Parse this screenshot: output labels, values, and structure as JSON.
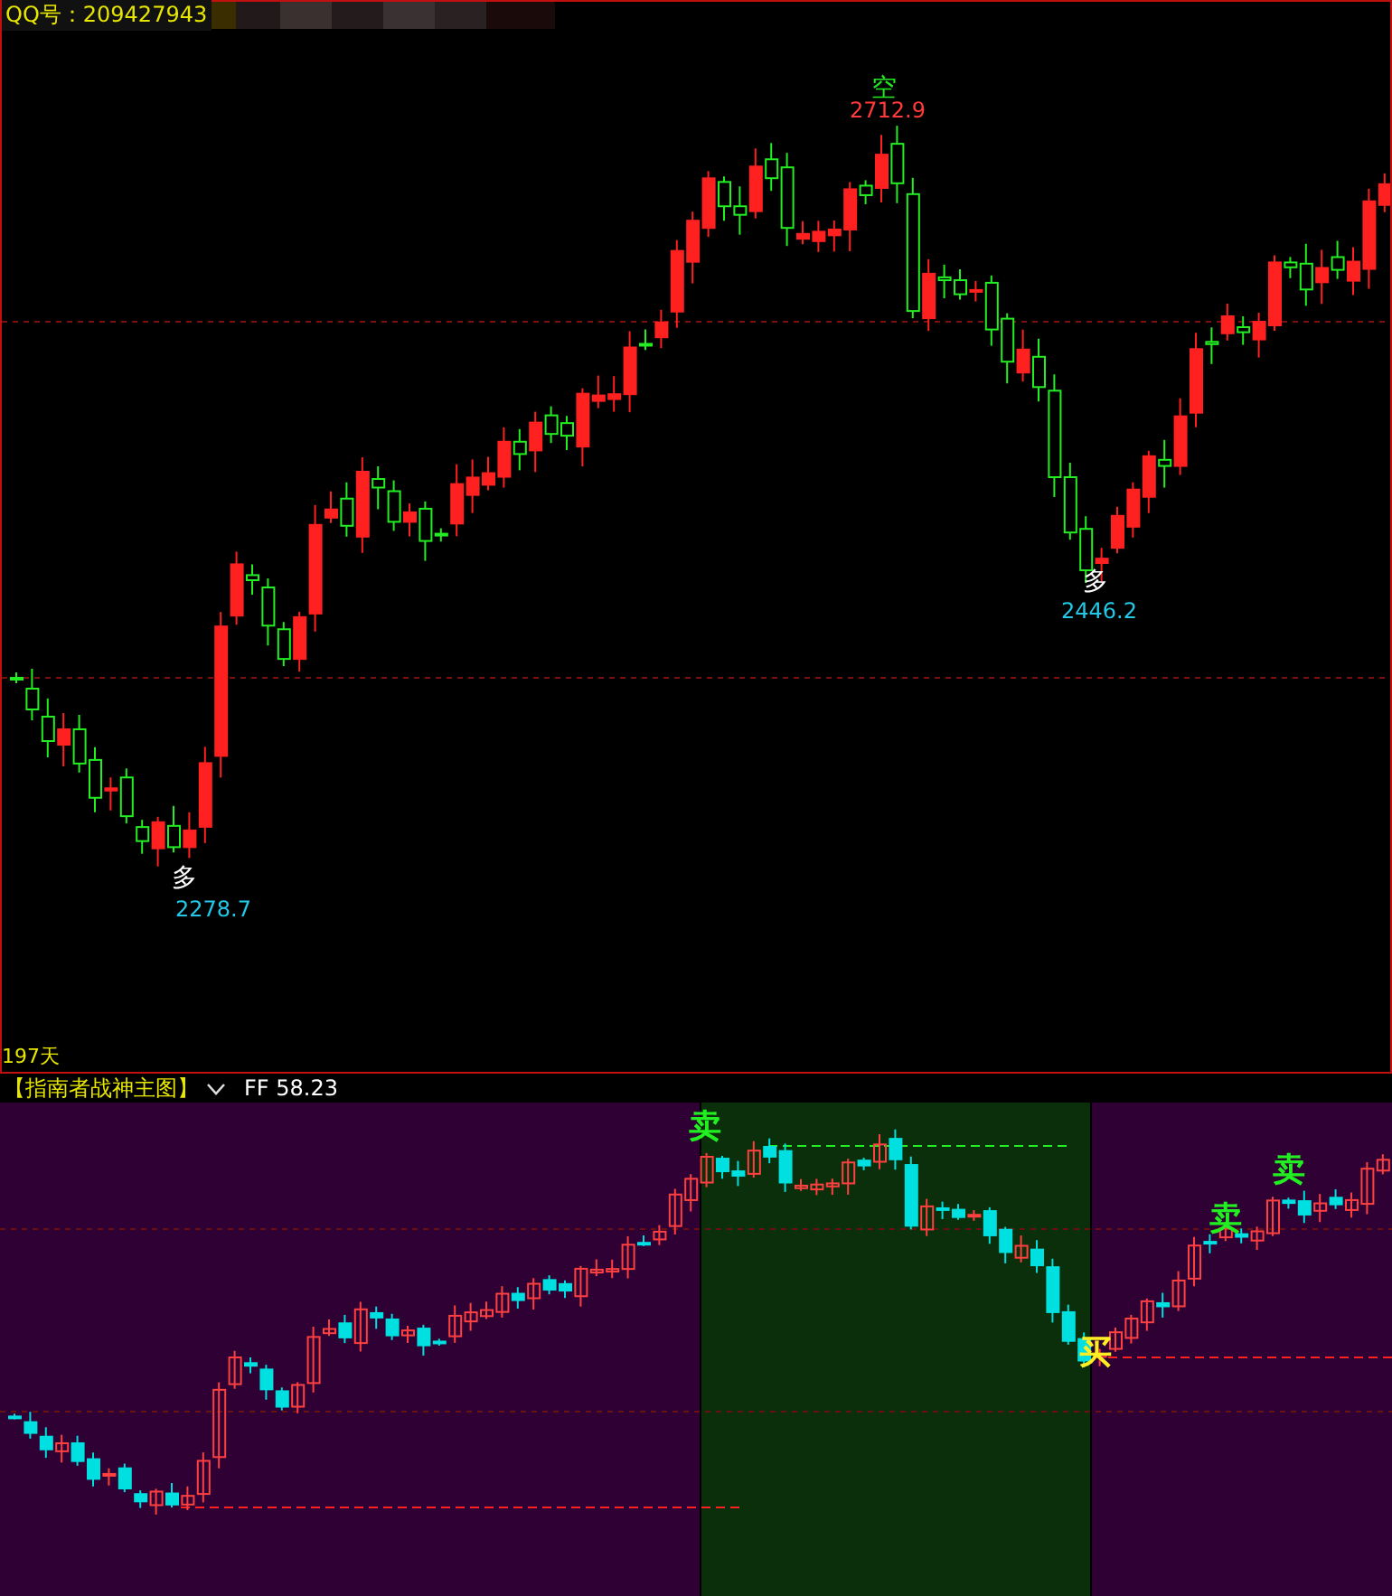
{
  "header": {
    "qq_label": "QQ号：209427943"
  },
  "price_chart": {
    "annotations": [
      {
        "kind": "low",
        "signal": "多",
        "price": "2278.7"
      },
      {
        "kind": "high",
        "signal": "空",
        "price": "2712.9"
      },
      {
        "kind": "low",
        "signal": "多",
        "price": "2446.2"
      }
    ],
    "period_label": "197天"
  },
  "indicator_panel": {
    "title": "【指南者战神主图】",
    "value_label": "FF 58.23",
    "signals": [
      {
        "kind": "sell",
        "text": "卖"
      },
      {
        "kind": "buy",
        "text": "买"
      },
      {
        "kind": "sell",
        "text": "卖"
      },
      {
        "kind": "sell",
        "text": "卖"
      }
    ]
  }
}
